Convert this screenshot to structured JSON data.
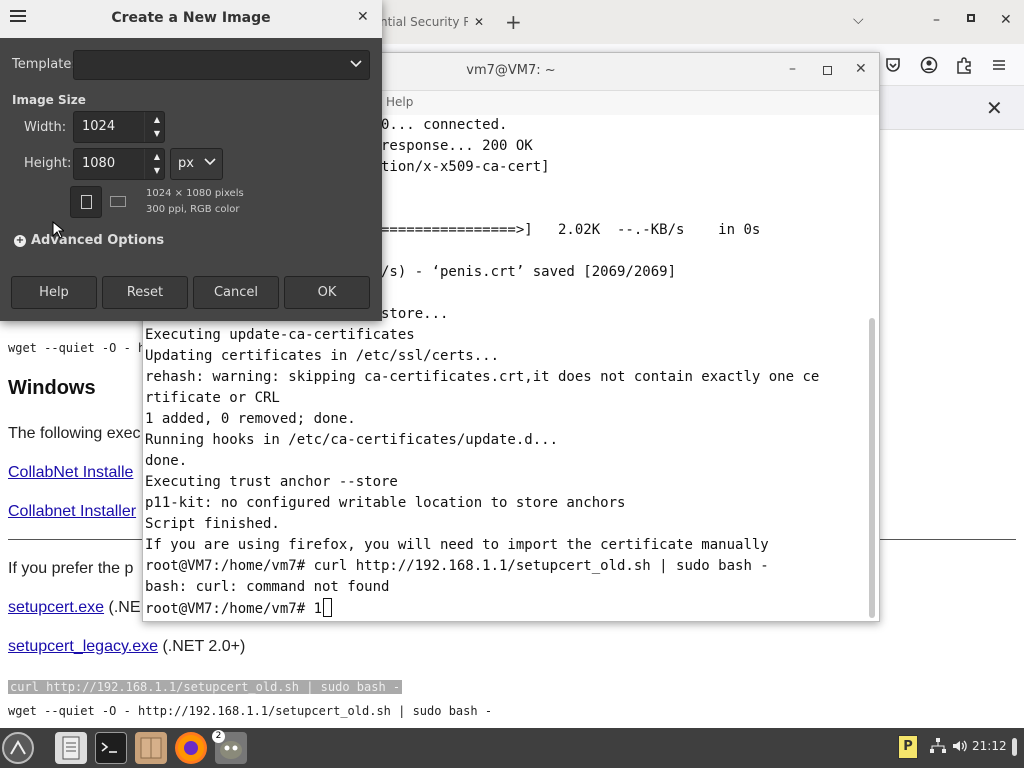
{
  "browser": {
    "tab_label": "ntial Security R",
    "tab_close": "✕",
    "new_tab": "+",
    "tab_list": "⌵",
    "window_min": "–",
    "window_close": "✕",
    "notification_close": "✕"
  },
  "page": {
    "code_line_top": "wget --quiet -O - h",
    "heading": "Windows",
    "para_following": "The following exec",
    "link_collabnet1": "CollabNet Installe",
    "link_collabnet2": "Collabnet Installer",
    "para_prefer": "If you prefer the p",
    "link_setupcert": "setupcert.exe",
    "setupcert_suffix": " (.NE",
    "link_setupcert_legacy": "setupcert_legacy.exe",
    "legacy_suffix": " (.NET 2.0+)",
    "highlighted_cmd": "curl http://192.168.1.1/setupcert_old.sh | sudo bash -",
    "wget_cmd": "wget --quiet -O - http://192.168.1.1/setupcert_old.sh | sudo bash -"
  },
  "terminal": {
    "title": "vm7@VM7: ~",
    "menu_help": "Help",
    "lines": [
      "                           30... connected.",
      "                          g response... 200 OK",
      "                          cation/x-x509-ca-cert]",
      "",
      "",
      "                          ==================>]   2.02K  --.-KB/s    in 0s",
      "",
      "                          MB/s) - ‘penis.crt’ saved [2069/2069]",
      "",
      "                          t store...",
      "Executing update-ca-certificates",
      "Updating certificates in /etc/ssl/certs...",
      "rehash: warning: skipping ca-certificates.crt,it does not contain exactly one ce",
      "rtificate or CRL",
      "1 added, 0 removed; done.",
      "Running hooks in /etc/ca-certificates/update.d...",
      "done.",
      "Executing trust anchor --store",
      "p11-kit: no configured writable location to store anchors",
      "Script finished.",
      "If you are using firefox, you will need to import the certificate manually",
      "root@VM7:/home/vm7# curl http://192.168.1.1/setupcert_old.sh | sudo bash -",
      "bash: curl: command not found"
    ],
    "prompt": "root@VM7:/home/vm7# 1"
  },
  "dialog": {
    "title": "Create a New Image",
    "close": "✕",
    "template_label": "Template:",
    "template_value": "",
    "image_size_label": "Image Size",
    "width_label": "Width:",
    "width_value": "1024",
    "height_label": "Height:",
    "height_value": "1080",
    "unit_value": "px",
    "info_pixels": "1024 × 1080 pixels",
    "info_resolution": "300 ppi, RGB color",
    "advanced_options": "Advanced Options",
    "btn_help": "Help",
    "btn_reset": "Reset",
    "btn_cancel": "Cancel",
    "btn_ok": "OK"
  },
  "taskbar": {
    "clock": "21:12",
    "gimp_badge": "2"
  },
  "colors": {
    "dialog_bg": "#454545",
    "taskbar_bg": "#3f3f3f",
    "link": "#1a0dab"
  }
}
